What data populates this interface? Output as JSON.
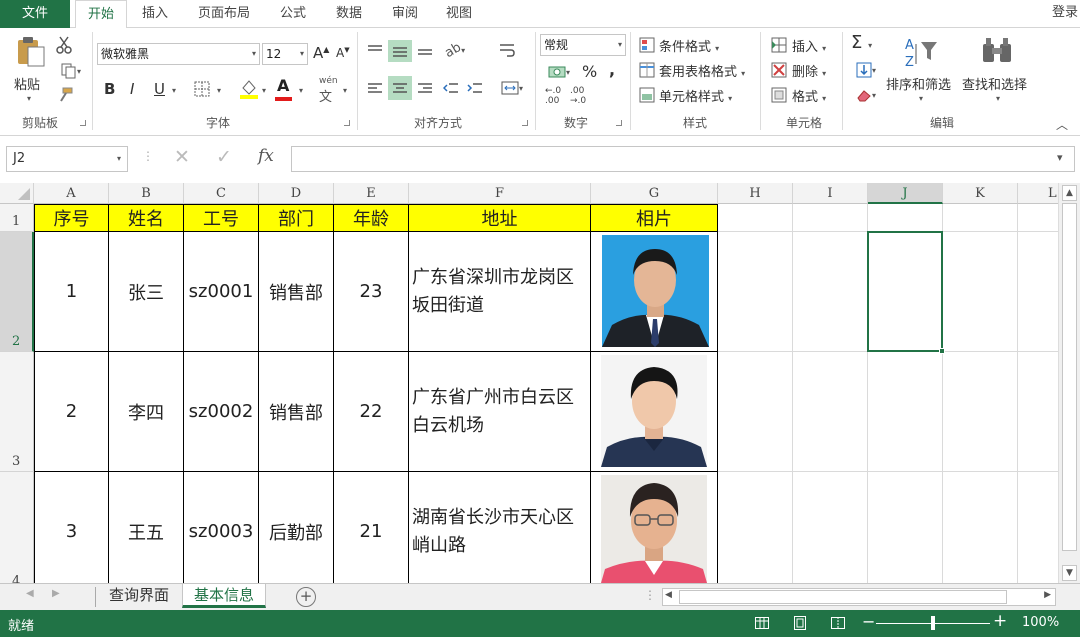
{
  "ribbon_tabs": {
    "file": "文件",
    "home": "开始",
    "insert": "插入",
    "page_layout": "页面布局",
    "formulas": "公式",
    "data": "数据",
    "review": "审阅",
    "view": "视图"
  },
  "login": "登录",
  "clipboard": {
    "paste": "粘贴",
    "label": "剪贴板"
  },
  "font": {
    "name": "微软雅黑",
    "size": "12",
    "bold": "B",
    "italic": "I",
    "underline": "U",
    "font_color_letter": "A",
    "phonetic": "wén",
    "grow": "A",
    "shrink": "A",
    "label": "字体"
  },
  "alignment": {
    "label": "对齐方式"
  },
  "number": {
    "format": "常规",
    "percent": "%",
    "comma": ",",
    "inc_decimal": ".00",
    "label": "数字"
  },
  "styles": {
    "conditional": "条件格式",
    "table_format": "套用表格格式",
    "cell_styles": "单元格样式",
    "label": "样式"
  },
  "cells": {
    "insert": "插入",
    "delete": "删除",
    "format": "格式",
    "label": "单元格"
  },
  "editing": {
    "sort_filter": "排序和筛选",
    "find_select": "查找和选择",
    "label": "编辑",
    "sigma": "Σ"
  },
  "formula_bar": {
    "name_box": "J2",
    "cancel": "✕",
    "enter": "✓",
    "fx": "fx",
    "value": ""
  },
  "columns": [
    "A",
    "B",
    "C",
    "D",
    "E",
    "F",
    "G",
    "H",
    "I",
    "J",
    "K",
    "L"
  ],
  "rows": [
    "1",
    "2",
    "3",
    "4"
  ],
  "table": {
    "headers": [
      "序号",
      "姓名",
      "工号",
      "部门",
      "年龄",
      "地址",
      "相片"
    ],
    "records": [
      {
        "no": "1",
        "name": "张三",
        "id": "sz0001",
        "dept": "销售部",
        "age": "23",
        "addr1": "广东省深圳市龙岗区",
        "addr2": "坂田街道"
      },
      {
        "no": "2",
        "name": "李四",
        "id": "sz0002",
        "dept": "销售部",
        "age": "22",
        "addr1": "广东省广州市白云区",
        "addr2": "白云机场"
      },
      {
        "no": "3",
        "name": "王五",
        "id": "sz0003",
        "dept": "后勤部",
        "age": "21",
        "addr1": "湖南省长沙市天心区",
        "addr2": "峭山路"
      }
    ]
  },
  "sheets": {
    "query": "查询界面",
    "basic": "基本信息",
    "add": "+"
  },
  "status": {
    "ready": "就绪",
    "zoom": "100%",
    "minus": "−",
    "plus": "+"
  },
  "colors": {
    "excel_green": "#217346",
    "header_fill": "#ffff00",
    "selection": "#217346"
  }
}
